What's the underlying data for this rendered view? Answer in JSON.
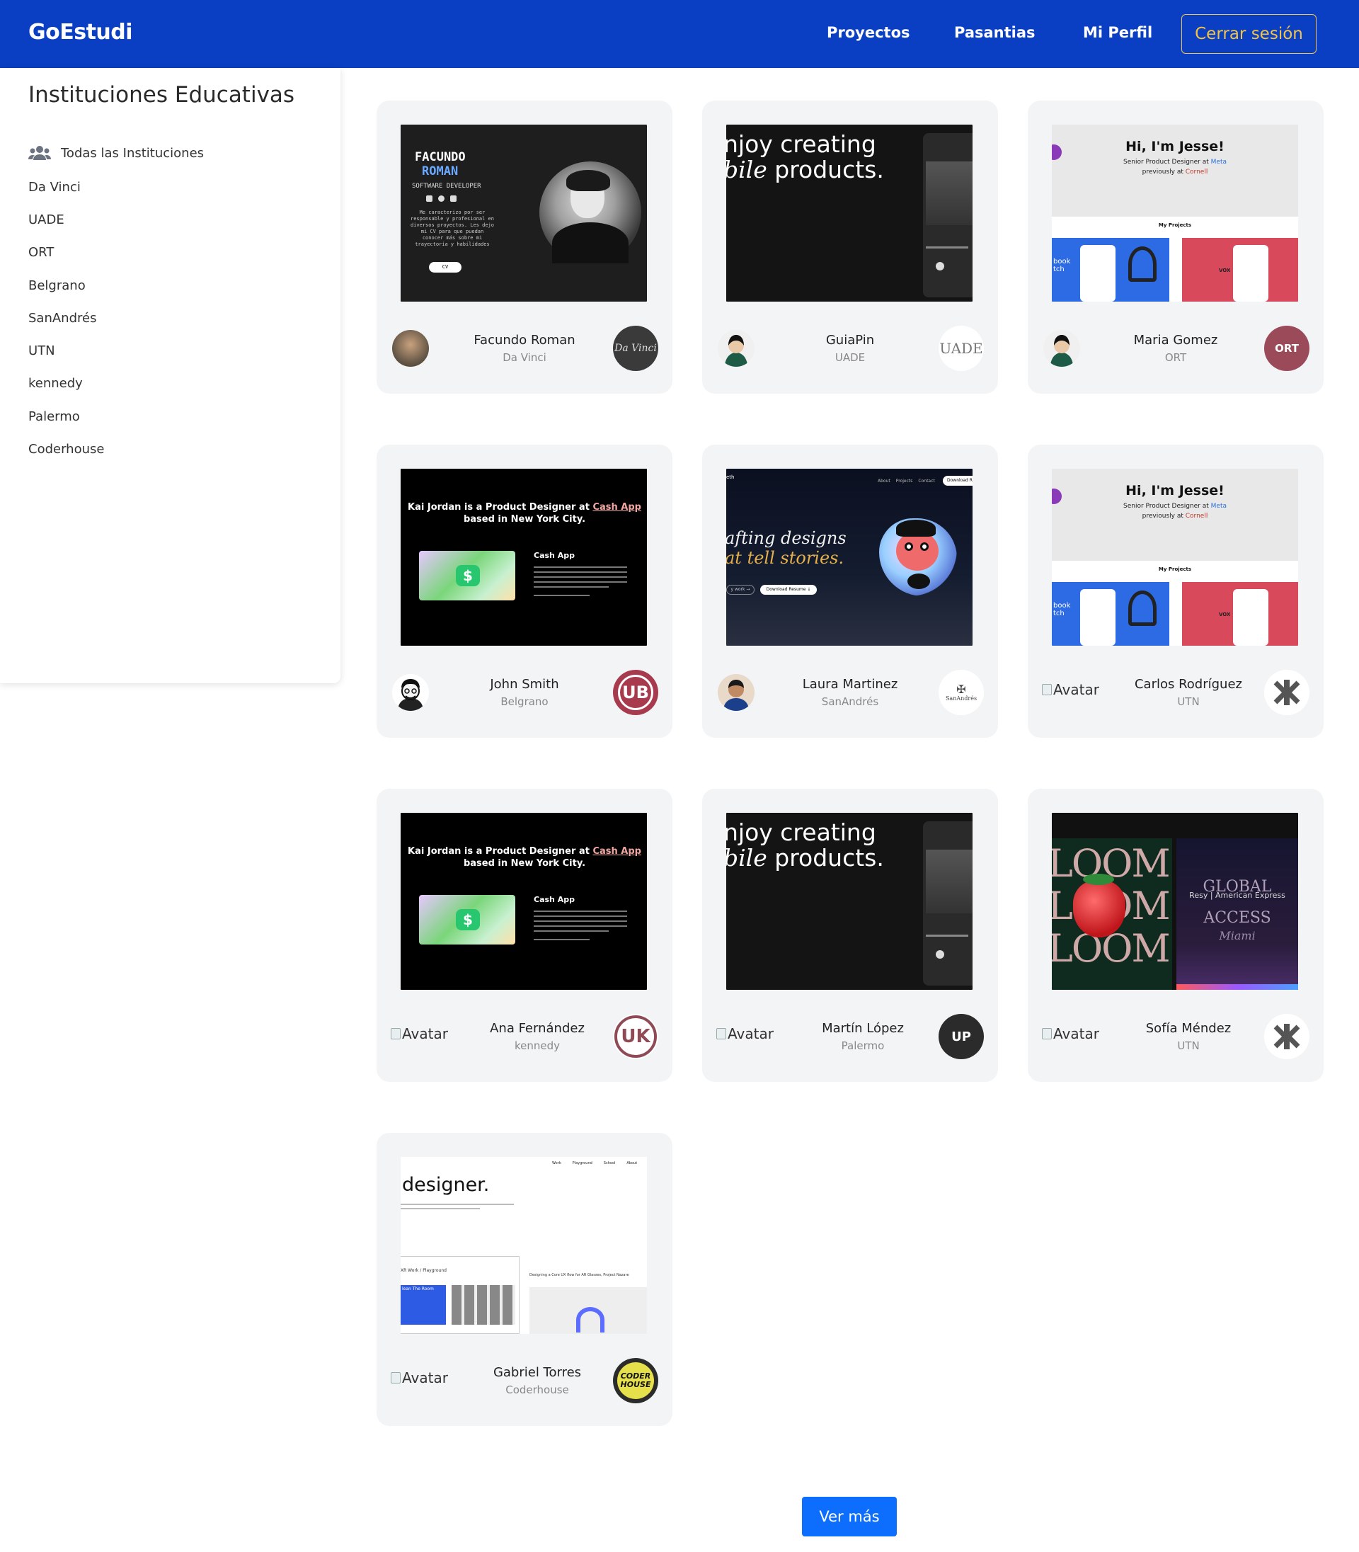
{
  "header": {
    "brand": "GoEstudi",
    "nav": [
      "Proyectos",
      "Pasantias",
      "Mi Perfil"
    ],
    "logout_label": "Cerrar sesión"
  },
  "sidebar": {
    "title": "Instituciones Educativas",
    "all_label": "Todas las Instituciones",
    "items": [
      "Da Vinci",
      "UADE",
      "ORT",
      "Belgrano",
      "SanAndrés",
      "UTN",
      "kennedy",
      "Palermo",
      "Coderhouse"
    ]
  },
  "cards": [
    {
      "name": "Facundo Roman",
      "institution": "Da Vinci",
      "avatar_alt": "Avatar"
    },
    {
      "name": "GuiaPin",
      "institution": "UADE",
      "avatar_alt": "Avatar"
    },
    {
      "name": "Maria Gomez",
      "institution": "ORT",
      "avatar_alt": "Avatar"
    },
    {
      "name": "John Smith",
      "institution": "Belgrano",
      "avatar_alt": "Avatar"
    },
    {
      "name": "Laura Martinez",
      "institution": "SanAndrés",
      "avatar_alt": "Avatar"
    },
    {
      "name": "Carlos Rodríguez",
      "institution": "UTN",
      "avatar_alt": "Avatar"
    },
    {
      "name": "Ana Fernández",
      "institution": "kennedy",
      "avatar_alt": "Avatar"
    },
    {
      "name": "Martín López",
      "institution": "Palermo",
      "avatar_alt": "Avatar"
    },
    {
      "name": "Sofía Méndez",
      "institution": "UTN",
      "avatar_alt": "Avatar"
    },
    {
      "name": "Gabriel Torres",
      "institution": "Coderhouse",
      "avatar_alt": "Avatar"
    }
  ],
  "previews": {
    "facundo": {
      "name_1": "FACUNDO",
      "name_2": "ROMAN",
      "role": "SOFTWARE DEVELOPER",
      "bio": "Me caracterizo por ser responsable y profesional en diversos proyectos. Les dejo mi CV para que puedan conocer más sobre mi trayectoria y habilidades",
      "cv": "CV"
    },
    "mobile": {
      "line_1": "njoy creating",
      "line_2a": "bile",
      "line_2b": " products."
    },
    "jesse": {
      "greeting": "Hi, I'm Jesse!",
      "subtitle_a": "Senior Product Designer at ",
      "company": "Meta",
      "subtitle_b": "previously at ",
      "school": "Cornell",
      "section": "My Projects",
      "tile": "book tch",
      "brand": "VOX"
    },
    "kai": {
      "headline_a": "Kai Jordan is a Product Designer at ",
      "headline_link": "Cash App",
      "headline_b": " based in New York City.",
      "project": "Cash App"
    },
    "laura": {
      "line_1": "afting designs",
      "line_2": "at tell stories.",
      "nav": [
        "About",
        "Projects",
        "Contact"
      ],
      "download": "Download R",
      "btn_work": "y work  →",
      "btn_resume": "Download Resume  ↓",
      "logo": "eth"
    },
    "loom": {
      "big": "LOOM",
      "global_1": "GLOBAL",
      "global_2": "ACCESS",
      "global_3": "Miami",
      "overlay": "Resy | American Express"
    },
    "designer": {
      "title": "designer.",
      "nav": [
        "Work",
        "Playground",
        "School",
        "About"
      ],
      "section": "XR Work / Playground",
      "item": "lean The Room",
      "meta": "Designing a Core UX flow for AR Glasses, Project Nazare"
    }
  },
  "logos": {
    "uade": "UADE",
    "ort": "ORT",
    "ub": "UB",
    "uk": "UK",
    "up": "UP",
    "coder": "CODER HOUSE"
  },
  "more_label": "Ver más",
  "colors": {
    "header": "#0a3fc4",
    "logout_border": "#f3c443",
    "button": "#0d6efd",
    "card_bg": "#f3f4f6"
  }
}
